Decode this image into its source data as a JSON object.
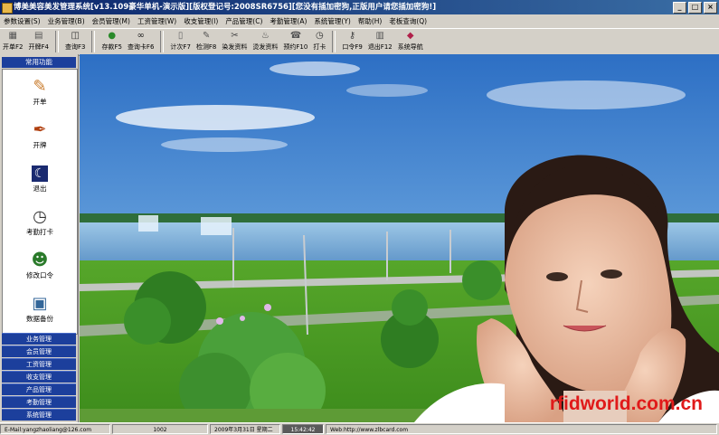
{
  "window": {
    "title": "博美美容美发管理系统[v13.109豪华单机-演示版][版权登记号:2008SR6756][您没有插加密狗,正版用户请您插加密狗!]",
    "controls": {
      "minimize": "_",
      "maximize": "□",
      "close": "×"
    }
  },
  "menu": [
    "参数设置(S)",
    "业务管理(B)",
    "会员管理(M)",
    "工资管理(W)",
    "收支管理(I)",
    "产品管理(C)",
    "考勤管理(A)",
    "系统管理(Y)",
    "帮助(H)",
    "老板查询(Q)"
  ],
  "toolbar": [
    {
      "label": "开单F2",
      "icon": "grid-icon",
      "glyph": "▦"
    },
    {
      "label": "开牌F4",
      "icon": "card-icon",
      "glyph": "▤"
    },
    {
      "label": "查询F3",
      "icon": "query-icon",
      "glyph": "◫"
    },
    {
      "label": "存款F5",
      "icon": "money-icon",
      "glyph": "●"
    },
    {
      "label": "查询卡F6",
      "icon": "binoculars-icon",
      "glyph": "∞"
    },
    {
      "label": "计次F7",
      "icon": "list-icon",
      "glyph": "▯"
    },
    {
      "label": "检测F8",
      "icon": "detect-icon",
      "glyph": "✎"
    },
    {
      "label": "染发资料",
      "icon": "dye-icon",
      "glyph": "✂"
    },
    {
      "label": "烫发资料",
      "icon": "perm-icon",
      "glyph": "♨"
    },
    {
      "label": "预约F10",
      "icon": "appointment-icon",
      "glyph": "☎"
    },
    {
      "label": "打卡",
      "icon": "clock-icon",
      "glyph": "◷"
    },
    {
      "label": "口令F9",
      "icon": "key-icon",
      "glyph": "⚷"
    },
    {
      "label": "退出F12",
      "icon": "door-icon",
      "glyph": "▥"
    },
    {
      "label": "系统导航",
      "icon": "navigate-icon",
      "glyph": "◆"
    }
  ],
  "sidebar": {
    "header": "常用功能",
    "items": [
      {
        "label": "开单",
        "icon": "edit-icon",
        "glyph": "✎",
        "color": "#c87a2a"
      },
      {
        "label": "开牌",
        "icon": "pen-icon",
        "glyph": "✒",
        "color": "#b04010"
      },
      {
        "label": "退出",
        "icon": "moon-icon",
        "glyph": "☾",
        "color": "#1a2a70"
      },
      {
        "label": "考勤打卡",
        "icon": "clock-icon",
        "glyph": "◷",
        "color": "#333333"
      },
      {
        "label": "修改口令",
        "icon": "users-icon",
        "glyph": "☻",
        "color": "#2a7a2a"
      },
      {
        "label": "数据备份",
        "icon": "backup-icon",
        "glyph": "▣",
        "color": "#336699"
      }
    ],
    "categories": [
      "业务管理",
      "会员管理",
      "工资管理",
      "收支管理",
      "产品管理",
      "考勤管理",
      "系统管理"
    ]
  },
  "statusbar": [
    "E-Mail:yangzhaoliang@126.com",
    "1002",
    "2009年3月31日 星期二",
    "15:42:42",
    "Web:http://www.zlbcard.com"
  ],
  "watermark": "rfidworld.com.cn",
  "colors": {
    "title_bg": "#0a246a",
    "category_bg": "#1c3f9c",
    "chrome": "#d4d0c8",
    "watermark": "#e01a1a"
  }
}
